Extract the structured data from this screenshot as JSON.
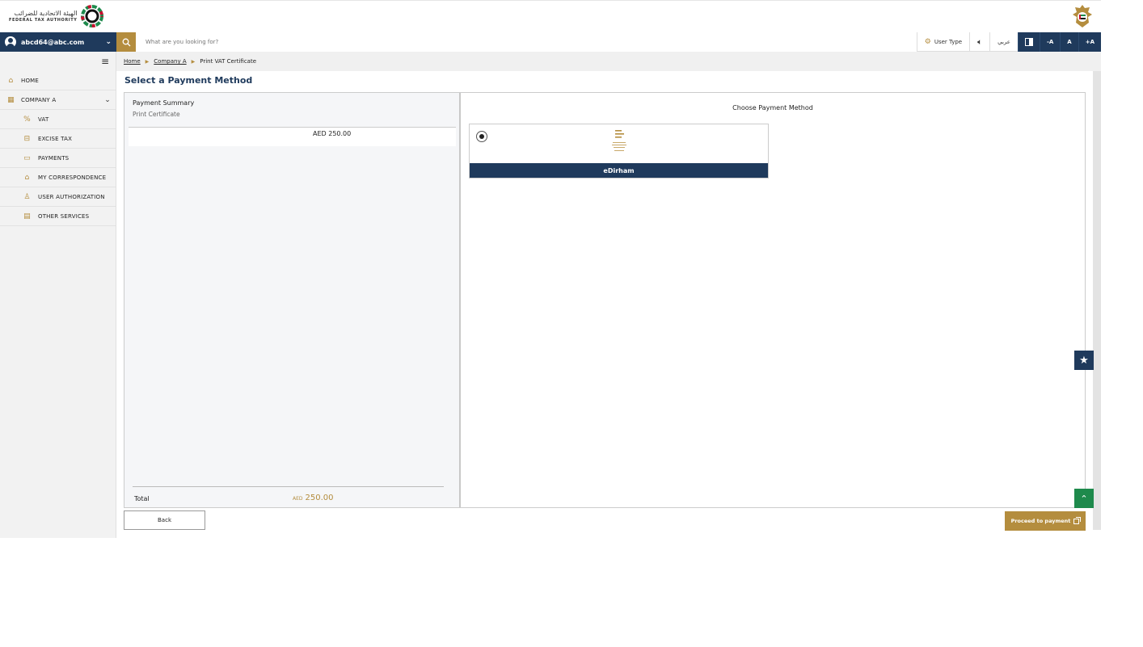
{
  "header": {
    "logo_ar": "الهيئة الاتحادية للضرائب",
    "logo_en": "FEDERAL TAX AUTHORITY"
  },
  "topbar": {
    "user_email": "abcd64@abc.com",
    "search_placeholder": "What are you looking for?",
    "user_type_label": "User Type",
    "language_label": "عربي",
    "font_decrease": "-A",
    "font_normal": "A",
    "font_increase": "+A"
  },
  "sidebar": {
    "items": [
      {
        "label": "HOME",
        "icon": "home-icon"
      },
      {
        "label": "COMPANY A",
        "icon": "grid-icon"
      },
      {
        "label": "VAT",
        "icon": "vat-icon"
      },
      {
        "label": "EXCISE TAX",
        "icon": "excise-icon"
      },
      {
        "label": "PAYMENTS",
        "icon": "payments-icon"
      },
      {
        "label": "MY CORRESPONDENCE",
        "icon": "bank-icon"
      },
      {
        "label": "USER AUTHORIZATION",
        "icon": "user-key-icon"
      },
      {
        "label": "OTHER SERVICES",
        "icon": "clipboard-icon"
      }
    ]
  },
  "breadcrumb": {
    "home": "Home",
    "company": "Company A",
    "current": "Print VAT Certificate"
  },
  "page": {
    "title": "Select a Payment Method"
  },
  "summary": {
    "title": "Payment Summary",
    "subtitle": "Print Certificate",
    "amount": "AED 250.00",
    "total_label": "Total",
    "total_currency": "AED",
    "total_value": "250.00"
  },
  "payment": {
    "title": "Choose Payment Method",
    "options": [
      {
        "label": "eDirham",
        "selected": true
      }
    ]
  },
  "actions": {
    "back": "Back",
    "proceed": "Proceed to payment"
  },
  "colors": {
    "navy": "#1f3a5c",
    "gold": "#b48d3e",
    "green": "#1e8a4c"
  }
}
